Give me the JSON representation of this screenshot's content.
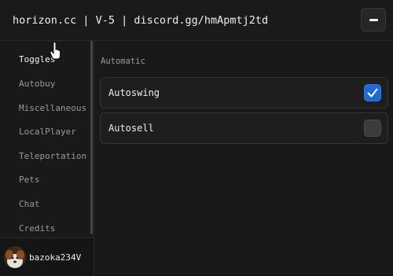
{
  "window": {
    "title": "horizon.cc | V-5 | discord.gg/hmApmtj2td",
    "minimize_icon": "minus-icon"
  },
  "sidebar": {
    "items": [
      {
        "label": "Toggles",
        "active": true
      },
      {
        "label": "Autobuy",
        "active": false
      },
      {
        "label": "Miscellaneous",
        "active": false
      },
      {
        "label": "LocalPlayer",
        "active": false
      },
      {
        "label": "Teleportation",
        "active": false
      },
      {
        "label": "Pets",
        "active": false
      },
      {
        "label": "Chat",
        "active": false
      },
      {
        "label": "Credits",
        "active": false
      }
    ],
    "user": {
      "name": "bazoka234V",
      "avatar_icon": "avatar-icon"
    }
  },
  "main": {
    "section_title": "Automatic",
    "toggles": [
      {
        "label": "Autoswing",
        "checked": true
      },
      {
        "label": "Autosell",
        "checked": false
      }
    ]
  },
  "colors": {
    "background": "#191919",
    "accent": "#1e6bd8",
    "text": "#e6e6e6",
    "muted_text": "#9a9a9a"
  }
}
